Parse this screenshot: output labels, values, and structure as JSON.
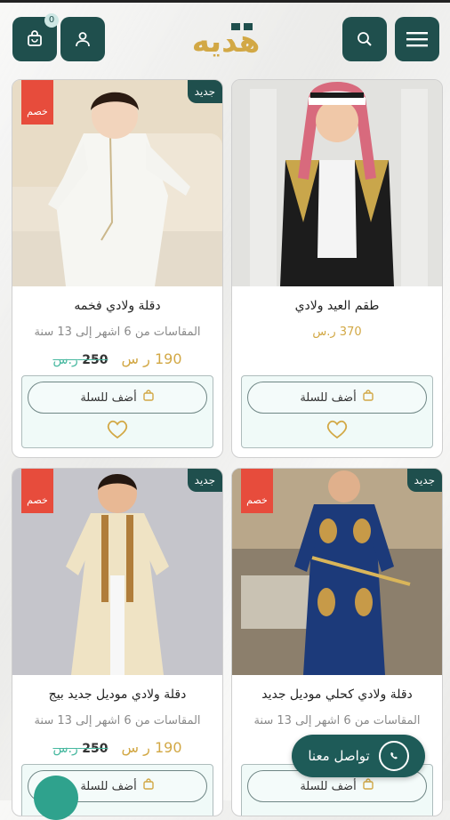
{
  "header": {
    "logo_text": "هديه",
    "cart_count": "0",
    "icons": [
      "cart-icon",
      "user-icon",
      "search-icon",
      "menu-icon"
    ]
  },
  "colors": {
    "brand": "#1f4f4d",
    "new_tag": "#1f4f4d",
    "sale_tag": "#e74c3c",
    "price": "#d2a845",
    "old_price": "#46b89f"
  },
  "products": [
    {
      "new_label": "جديد",
      "sale_label": "خصم",
      "title": "دقلة ولادي فخمه",
      "subtitle": "المقاسات من 6 اشهر إلى 13 سنة",
      "price": "190",
      "currency": "ر س",
      "old_price": "250",
      "old_currency": "ر.س",
      "add_label": "أضف للسلة"
    },
    {
      "new_label": "",
      "sale_label": "",
      "title": "طقم العيد ولادي",
      "subtitle": "",
      "price": "370",
      "currency": "ر.س",
      "old_price": "",
      "old_currency": "",
      "add_label": "أضف للسلة"
    },
    {
      "new_label": "جديد",
      "sale_label": "خصم",
      "title": "دقلة ولادي موديل جديد بيج",
      "subtitle": "المقاسات من 6 اشهر إلى 13 سنة",
      "price": "190",
      "currency": "ر س",
      "old_price": "250",
      "old_currency": "ر.س",
      "add_label": "أضف للسلة"
    },
    {
      "new_label": "جديد",
      "sale_label": "خصم",
      "title": "دقلة ولادي كحلي موديل جديد",
      "subtitle": "المقاسات من 6 اشهر إلى 13 سنة",
      "price": "",
      "currency": "",
      "old_price": "",
      "old_currency": "",
      "add_label": "أضف للسلة"
    }
  ],
  "whatsapp": {
    "label": "تواصل معنا"
  }
}
